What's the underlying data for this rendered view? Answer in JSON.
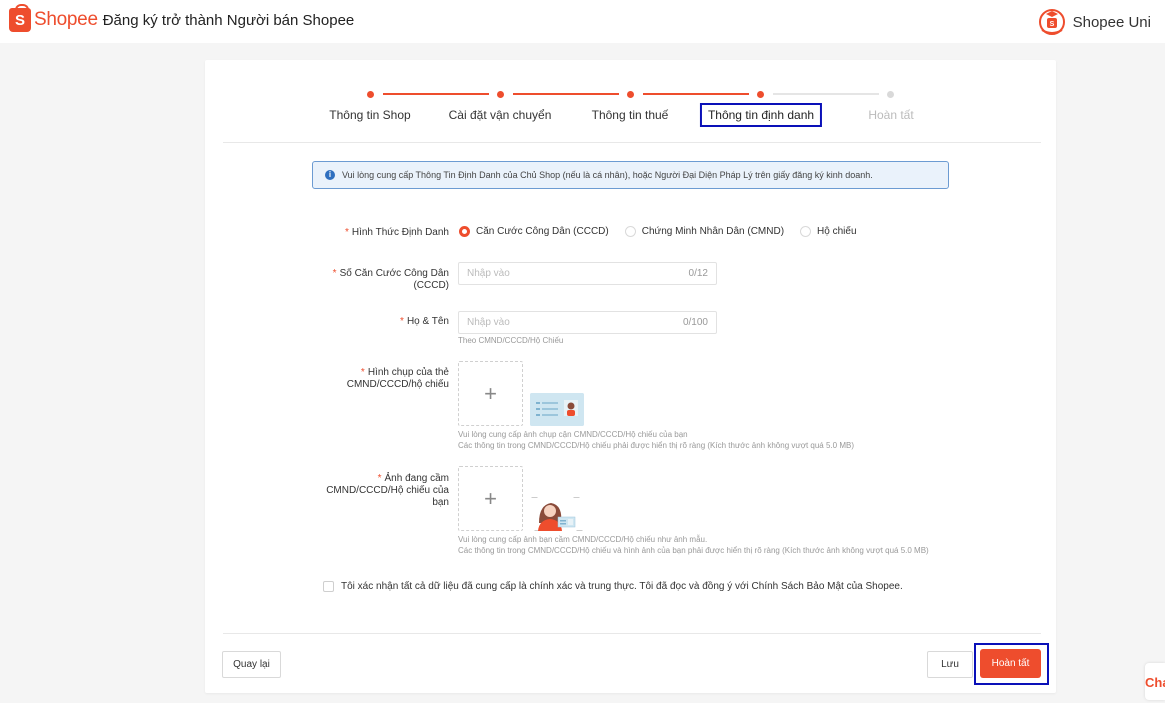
{
  "header": {
    "brand": "Shopee",
    "brand_glyph": "S",
    "title": "Đăng ký trở thành Người bán Shopee",
    "uni_label": "Shopee Uni"
  },
  "steps": [
    {
      "label": "Thông tin Shop",
      "state": "done"
    },
    {
      "label": "Cài đặt vận chuyển",
      "state": "done"
    },
    {
      "label": "Thông tin thuế",
      "state": "done"
    },
    {
      "label": "Thông tin định danh",
      "state": "current"
    },
    {
      "label": "Hoàn tất",
      "state": "pending"
    }
  ],
  "notice": {
    "icon": "info-icon",
    "icon_glyph": "i",
    "text": "Vui lòng cung cấp Thông Tin Định Danh của Chủ Shop (nếu là cá nhân), hoặc Người Đại Diện Pháp Lý trên giấy đăng ký kinh doanh."
  },
  "form": {
    "required_mark": "*",
    "id_type": {
      "label": "Hình Thức Định Danh",
      "options": [
        {
          "label": "Căn Cước Công Dân (CCCD)",
          "checked": true
        },
        {
          "label": "Chứng Minh Nhân Dân (CMND)",
          "checked": false
        },
        {
          "label": "Hộ chiếu",
          "checked": false
        }
      ]
    },
    "id_number": {
      "label_line1": "Số Căn Cước Công Dân",
      "label_line2": "(CCCD)",
      "placeholder": "Nhập vào",
      "counter": "0/12"
    },
    "full_name": {
      "label": "Họ & Tên",
      "placeholder": "Nhập vào",
      "counter": "0/100",
      "hint": "Theo CMND/CCCD/Hộ Chiếu"
    },
    "id_photo": {
      "label_line1": "Hình chụp của thẻ",
      "label_line2": "CMND/CCCD/hộ chiếu",
      "upload_glyph": "+",
      "hint_line1": "Vui lòng cung cấp ảnh chụp cận CMND/CCCD/Hộ chiếu của bạn",
      "hint_line2": "Các thông tin trong CMND/CCCD/Hộ chiếu phải được hiển thị rõ ràng (Kích thước ảnh không vượt quá 5.0 MB)"
    },
    "selfie_photo": {
      "label_line1": "Ảnh đang cầm",
      "label_line2": "CMND/CCCD/Hộ chiếu của",
      "label_line3": "bạn",
      "upload_glyph": "+",
      "hint_line1": "Vui lòng cung cấp ảnh bạn cầm CMND/CCCD/Hộ chiếu như ảnh mẫu.",
      "hint_line2": "Các thông tin trong CMND/CCCD/Hộ chiếu và hình ảnh của bạn phải được hiển thị rõ ràng (Kích thước ảnh không vượt quá 5.0 MB)"
    },
    "consent": {
      "text": "Tôi xác nhận tất cả dữ liệu đã cung cấp là chính xác và trung thực. Tôi đã đọc và đồng ý với Chính Sách Bảo Mật của Shopee.",
      "checked": false
    }
  },
  "footer": {
    "back_label": "Quay lại",
    "save_label": "Lưu",
    "finish_label": "Hoàn tất"
  },
  "chat_tab": {
    "label": "Cha"
  },
  "colors": {
    "brand": "#ee4d2d",
    "highlight_frame": "#0a10b8",
    "notice_border": "#6c9bd2",
    "notice_bg": "#eaf2fb"
  }
}
